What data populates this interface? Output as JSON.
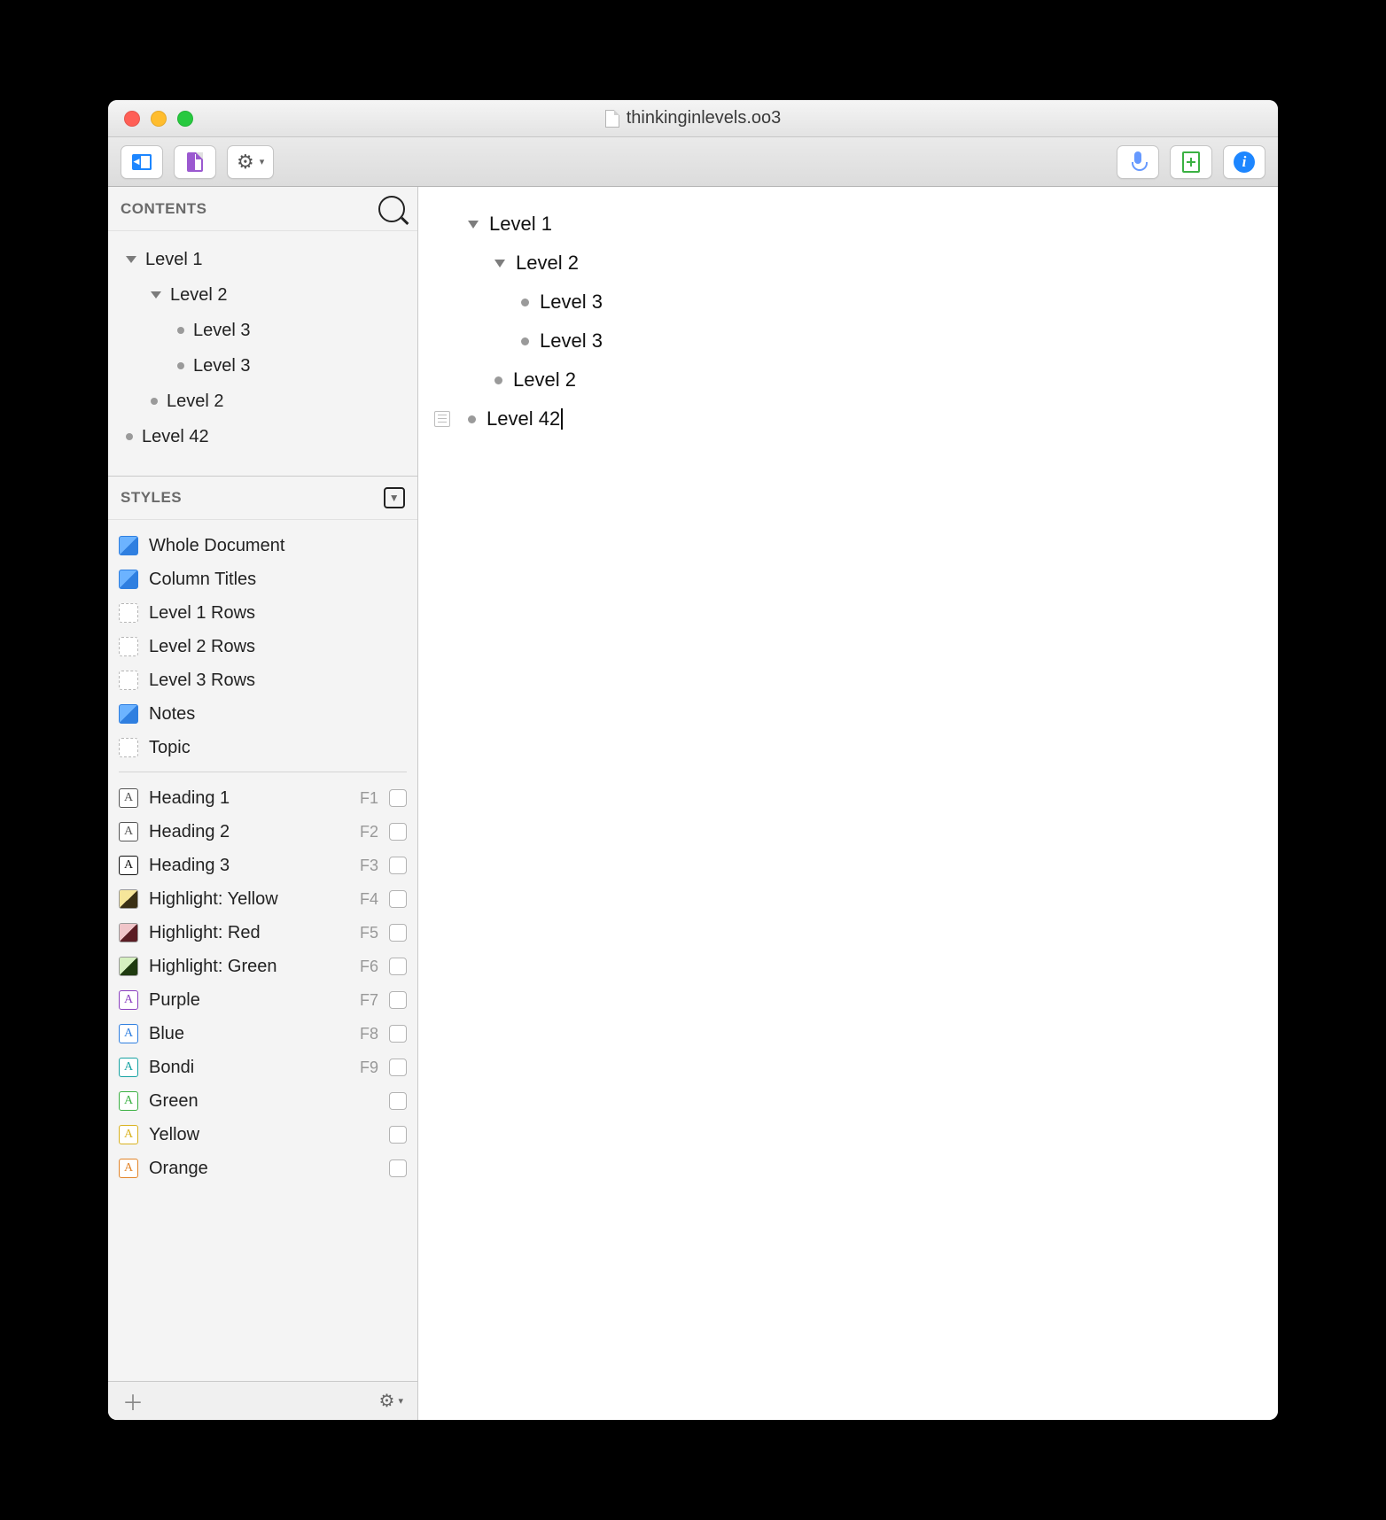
{
  "window": {
    "title": "thinkinginlevels.oo3"
  },
  "sidebar": {
    "contents": {
      "header": "CONTENTS",
      "items": [
        {
          "label": "Level 1",
          "type": "arrow",
          "indent": 1
        },
        {
          "label": "Level 2",
          "type": "arrow",
          "indent": 2
        },
        {
          "label": "Level 3",
          "type": "dot",
          "indent": 3
        },
        {
          "label": "Level 3",
          "type": "dot",
          "indent": 3
        },
        {
          "label": "Level 2",
          "type": "dot",
          "indent": 2
        },
        {
          "label": "Level 42",
          "type": "dot",
          "indent": 1
        }
      ]
    },
    "styles": {
      "header": "STYLES",
      "builtins": [
        {
          "label": "Whole Document",
          "swatch": "blue"
        },
        {
          "label": "Column Titles",
          "swatch": "blue"
        },
        {
          "label": "Level 1 Rows",
          "swatch": "dash"
        },
        {
          "label": "Level 2 Rows",
          "swatch": "dash"
        },
        {
          "label": "Level 3 Rows",
          "swatch": "dash"
        },
        {
          "label": "Notes",
          "swatch": "blue"
        },
        {
          "label": "Topic",
          "swatch": "dash"
        }
      ],
      "named": [
        {
          "label": "Heading 1",
          "key": "F1",
          "swatch": "A",
          "color": "#555"
        },
        {
          "label": "Heading 2",
          "key": "F2",
          "swatch": "A",
          "color": "#555"
        },
        {
          "label": "Heading 3",
          "key": "F3",
          "swatch": "A",
          "color": "#111"
        },
        {
          "label": "Highlight: Yellow",
          "key": "F4",
          "swatch": "HY"
        },
        {
          "label": "Highlight: Red",
          "key": "F5",
          "swatch": "HR"
        },
        {
          "label": "Highlight: Green",
          "key": "F6",
          "swatch": "HG"
        },
        {
          "label": "Purple",
          "key": "F7",
          "swatch": "A",
          "color": "#8a3fbf"
        },
        {
          "label": "Blue",
          "key": "F8",
          "swatch": "A",
          "color": "#2f7fe0"
        },
        {
          "label": "Bondi",
          "key": "F9",
          "swatch": "A",
          "color": "#18a3a3"
        },
        {
          "label": "Green",
          "key": "",
          "swatch": "A",
          "color": "#3bb143"
        },
        {
          "label": "Yellow",
          "key": "",
          "swatch": "A",
          "color": "#d9b21f"
        },
        {
          "label": "Orange",
          "key": "",
          "swatch": "A",
          "color": "#e2852a"
        }
      ]
    }
  },
  "outline": {
    "rows": [
      {
        "label": "Level 1",
        "type": "arrow",
        "indent": 1,
        "note": false
      },
      {
        "label": "Level 2",
        "type": "arrow",
        "indent": 2,
        "note": false
      },
      {
        "label": "Level 3",
        "type": "dot",
        "indent": 3,
        "note": false
      },
      {
        "label": "Level 3",
        "type": "dot",
        "indent": 3,
        "note": false
      },
      {
        "label": "Level 2",
        "type": "dot",
        "indent": 2,
        "note": false
      },
      {
        "label": "Level 42",
        "type": "dot",
        "indent": 1,
        "note": true,
        "editing": true
      }
    ]
  }
}
